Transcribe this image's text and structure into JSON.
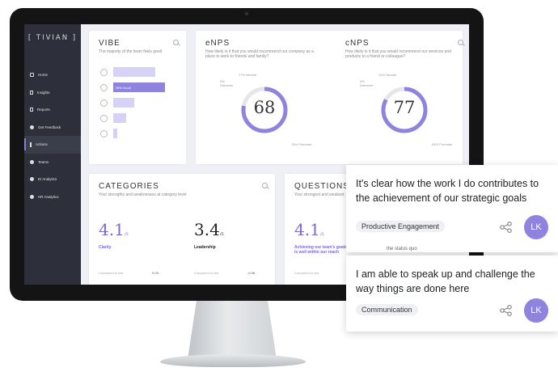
{
  "app": {
    "logo": "[ TIVIAN ]"
  },
  "sidebar": {
    "items": [
      {
        "label": "Home",
        "icon": "house-icon"
      },
      {
        "label": "Insights",
        "icon": "insights-icon"
      },
      {
        "label": "Reports",
        "icon": "report-icon"
      },
      {
        "label": "Get Feedback",
        "icon": "feedback-icon"
      },
      {
        "label": "Actions",
        "icon": "bulb-icon",
        "active": true
      },
      {
        "label": "Teams",
        "icon": "team-icon"
      },
      {
        "label": "EI Analytics",
        "icon": "analytics-icon"
      },
      {
        "label": "HR Analytics",
        "icon": "analytics-icon"
      }
    ]
  },
  "vibe": {
    "title": "VIBE",
    "subtitle": "The majority of the team feels good",
    "bars": [
      {
        "value": 0.65,
        "label": ""
      },
      {
        "value": 0.8,
        "label": "38% Good",
        "highlight": true
      },
      {
        "value": 0.33,
        "label": ""
      },
      {
        "value": 0.2,
        "label": ""
      },
      {
        "value": 0.06,
        "label": ""
      }
    ]
  },
  "enps": {
    "title": "eNPS",
    "subtitle": "How likely is it that you would recommend our company as a place to work to friends and family?",
    "score": "68",
    "labels": [
      "17% Neutral",
      "5% Detractor",
      "78% Promoter"
    ],
    "promoter_fraction": 0.78
  },
  "cnps": {
    "title": "cNPS",
    "subtitle": "How likely is it that you would recommend our services and products to a friend or colleague?",
    "score": "77",
    "labels": [
      "14% Neutral",
      "3% Detractor",
      "83% Promoter"
    ],
    "promoter_fraction": 0.83
  },
  "categories": {
    "title": "CATEGORIES",
    "subtitle": "Your strengths and weaknesses at category level",
    "items": [
      {
        "score": "4.1",
        "scale": "/5",
        "name": "Clarity",
        "color": "#7a6ad8",
        "compare": "Compared to last",
        "delta": "0.03"
      },
      {
        "score": "3.4",
        "scale": "/5",
        "name": "Leadership",
        "color": "#222222",
        "compare": "Compared to last",
        "delta": "-0.08"
      }
    ]
  },
  "questions": {
    "title": "QUESTIONS",
    "subtitle": "Your strongest and weakest",
    "score": "4.1",
    "scale": "/5",
    "text": "Achieving our team's goals is well within our reach",
    "compare": "Compared to last"
  },
  "float_cards": [
    {
      "text": "It's clear how the work I do contributes to the achievement of our strategic goals",
      "tag": "Productive Engagement",
      "avatar": "LK",
      "behind_text": "the status quo"
    },
    {
      "text": "I am able to speak up and challenge the way things are done here",
      "tag": "Communication",
      "avatar": "LK"
    }
  ],
  "colors": {
    "accent": "#8e83de",
    "accent_light": "#d6d2f5",
    "sidebar": "#2d2f3a"
  }
}
